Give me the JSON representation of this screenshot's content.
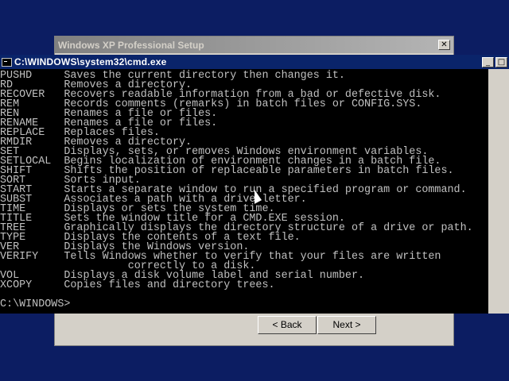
{
  "setup_dialog": {
    "title": "Windows XP Professional Setup",
    "close_label": "✕",
    "back_label": "< Back",
    "next_label": "Next >"
  },
  "cmd_window": {
    "title": "C:\\WINDOWS\\system32\\cmd.exe",
    "minimize_label": "_",
    "maximize_label": "□",
    "lines": [
      {
        "cmd": "PUSHD",
        "desc": "Saves the current directory then changes it."
      },
      {
        "cmd": "RD",
        "desc": "Removes a directory."
      },
      {
        "cmd": "RECOVER",
        "desc": "Recovers readable information from a bad or defective disk."
      },
      {
        "cmd": "REM",
        "desc": "Records comments (remarks) in batch files or CONFIG.SYS."
      },
      {
        "cmd": "REN",
        "desc": "Renames a file or files."
      },
      {
        "cmd": "RENAME",
        "desc": "Renames a file or files."
      },
      {
        "cmd": "REPLACE",
        "desc": "Replaces files."
      },
      {
        "cmd": "RMDIR",
        "desc": "Removes a directory."
      },
      {
        "cmd": "SET",
        "desc": "Displays, sets, or removes Windows environment variables."
      },
      {
        "cmd": "SETLOCAL",
        "desc": "Begins localization of environment changes in a batch file."
      },
      {
        "cmd": "SHIFT",
        "desc": "Shifts the position of replaceable parameters in batch files."
      },
      {
        "cmd": "SORT",
        "desc": "Sorts input."
      },
      {
        "cmd": "START",
        "desc": "Starts a separate window to run a specified program or command."
      },
      {
        "cmd": "SUBST",
        "desc": "Associates a path with a drive letter."
      },
      {
        "cmd": "TIME",
        "desc": "Displays or sets the system time."
      },
      {
        "cmd": "TITLE",
        "desc": "Sets the window title for a CMD.EXE session."
      },
      {
        "cmd": "TREE",
        "desc": "Graphically displays the directory structure of a drive or path."
      },
      {
        "cmd": "TYPE",
        "desc": "Displays the contents of a text file."
      },
      {
        "cmd": "VER",
        "desc": "Displays the Windows version."
      },
      {
        "cmd": "VERIFY",
        "desc": "Tells Windows whether to verify that your files are written"
      },
      {
        "cmd": "",
        "desc": "correctly to a disk."
      },
      {
        "cmd": "VOL",
        "desc": "Displays a disk volume label and serial number."
      },
      {
        "cmd": "XCOPY",
        "desc": "Copies files and directory trees."
      },
      {
        "cmd": "",
        "desc": ""
      },
      {
        "cmd": "C:\\WINDOWS>",
        "desc": "",
        "prompt": true
      }
    ]
  },
  "colors": {
    "desktop": "#0c1d62",
    "console_bg": "#000000",
    "console_text": "#c0c0c0",
    "title_active": "#0a246a"
  }
}
